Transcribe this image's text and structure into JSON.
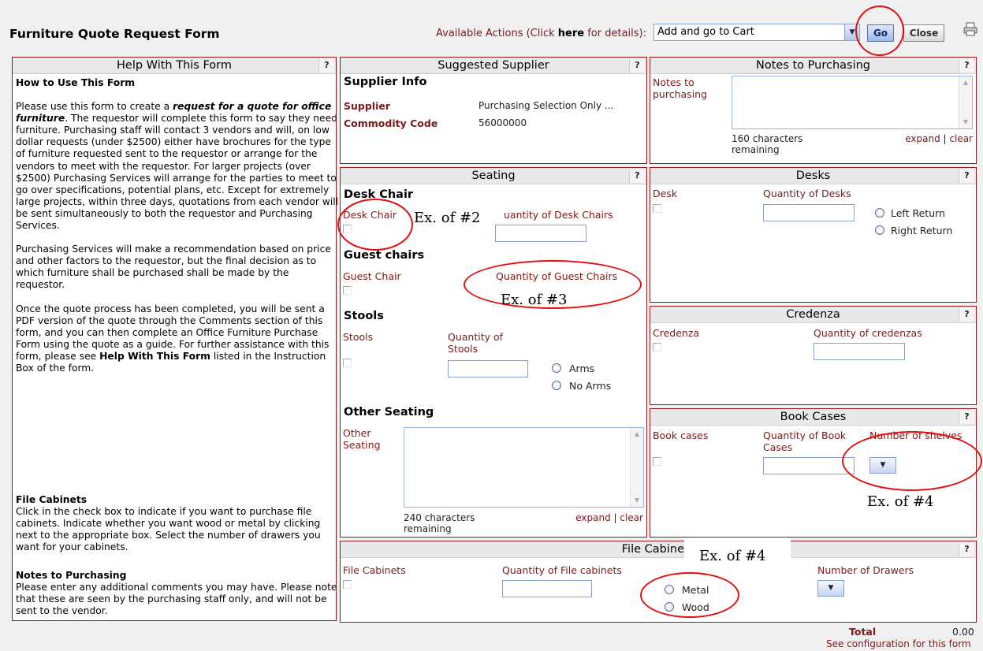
{
  "header": {
    "title": "Furniture Quote Request Form",
    "actions_prefix": "Available Actions (Click ",
    "actions_link": "here",
    "actions_suffix": " for details):",
    "action_selected": "Add and go to Cart",
    "go_label": "Go",
    "close_label": "Close"
  },
  "help": {
    "title": "Help With This Form",
    "how_title": "How to Use This Form",
    "p1_pre": "Please use this form to create a ",
    "p1_em": "request for a quote for office furniture",
    "p1_post": ". The requestor will complete this form to say they need furniture. Purchasing staff will contact 3 vendors and will, on low dollar requests (under $2500) either have brochures for the type of furniture requested sent to the requestor or arrange for the vendors to meet with the requestor. For larger projects (over $2500) Purchasing Services will arrange for the parties to meet to go over specifications, potential plans, etc. Except for extremely large projects, within three days, quotations from each vendor will be sent simultaneously to both the requestor and Purchasing Services.",
    "p2": "Purchasing Services will make a recommendation based on price and other factors to the requestor, but the final decision as to which furniture shall be purchased shall be made by the requestor.",
    "p3_pre": "Once the quote process has been completed, you will be sent a PDF version of the quote through the Comments section of this form, and you can then complete an Office Furniture Purchase Form using the quote as a guide. For further assistance with this form, please see ",
    "p3_bold": "Help With This Form",
    "p3_post": " listed in the Instruction Box of the form.",
    "file_title": "File Cabinets",
    "file_text": "Click in the check box to indicate if you want to purchase file cabinets. Indicate whether you want wood or metal by clicking next to the appropriate box. Select the number of drawers you want for your cabinets.",
    "notes_title": "Notes to Purchasing",
    "notes_text": "Please enter any additional comments you may have. Please note that these are seen by the purchasing staff only, and will not be sent to the vendor."
  },
  "supplier": {
    "title": "Suggested Supplier",
    "section": "Supplier Info",
    "supplier_label": "Supplier",
    "supplier_value": "Purchasing Selection Only ...",
    "commodity_label": "Commodity Code",
    "commodity_value": "56000000"
  },
  "notes": {
    "title": "Notes to Purchasing",
    "label": "Notes to purchasing",
    "remaining": "160 characters remaining",
    "expand": "expand",
    "sep": " | ",
    "clear": "clear"
  },
  "seating": {
    "title": "Seating",
    "desk_chair_section": "Desk Chair",
    "desk_chair_label": "Desk Chair",
    "desk_chair_qty_label": "uantity of Desk Chairs",
    "guest_section": "Guest chairs",
    "guest_label": "Guest Chair",
    "guest_qty_label": "Quantity of Guest Chairs",
    "stools_section": "Stools",
    "stools_label": "Stools",
    "stools_qty_label": "Quantity of Stools",
    "arms": "Arms",
    "no_arms": "No Arms",
    "other_section": "Other Seating",
    "other_label": "Other Seating",
    "remaining": "240 characters remaining",
    "expand": "expand",
    "sep": " | ",
    "clear": "clear"
  },
  "desks": {
    "title": "Desks",
    "desk_label": "Desk",
    "qty_label": "Quantity of Desks",
    "left": "Left Return",
    "right": "Right Return"
  },
  "credenza": {
    "title": "Credenza",
    "label": "Credenza",
    "qty_label": "Quantity of credenzas"
  },
  "bookcases": {
    "title": "Book Cases",
    "label": "Book cases",
    "qty_label": "Quantity of Book Cases",
    "shelves_label": "Number of shelves"
  },
  "filecab": {
    "title": "File Cabinets",
    "label": "File Cabinets",
    "qty_label": "Quantity of File cabinets",
    "metal": "Metal",
    "wood": "Wood",
    "drawers_label": "Number of Drawers"
  },
  "footer": {
    "total_label": "Total",
    "total_value": "0.00",
    "config_link": "See configuration for this form"
  },
  "annotations": {
    "ex2": "Ex. of #2",
    "ex3": "Ex. of #3",
    "ex4a": "Ex. of #4",
    "ex4b": "Ex. of #4",
    "ring_color": "#e01010"
  },
  "help_question": "?"
}
